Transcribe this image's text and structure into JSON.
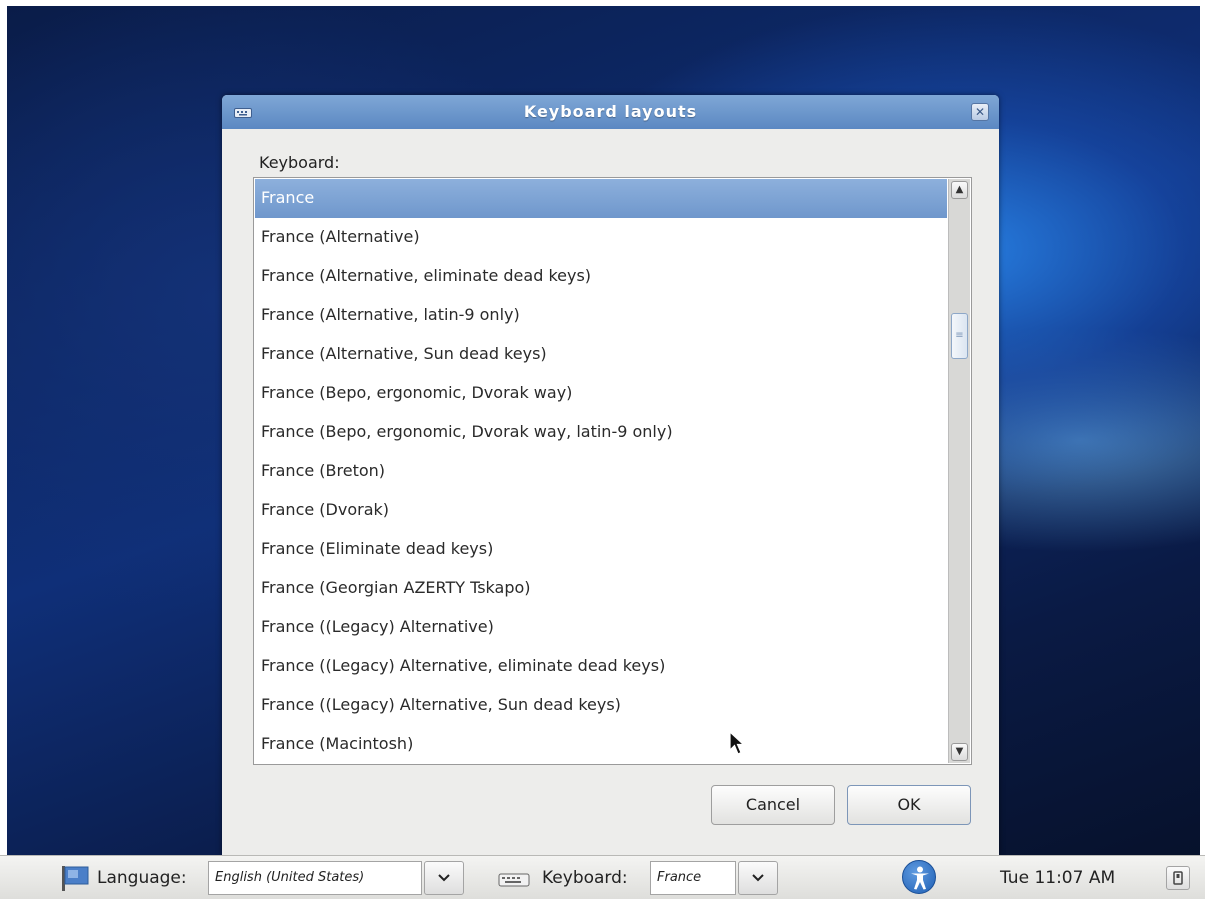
{
  "dialog": {
    "title": "Keyboard layouts",
    "keyboard_label": "Keyboard:",
    "layouts": [
      "France",
      "France (Alternative)",
      "France (Alternative, eliminate dead keys)",
      "France (Alternative, latin-9 only)",
      "France (Alternative, Sun dead keys)",
      "France (Bepo, ergonomic, Dvorak way)",
      "France (Bepo, ergonomic, Dvorak way, latin-9 only)",
      "France (Breton)",
      "France (Dvorak)",
      "France (Eliminate dead keys)",
      "France (Georgian AZERTY Tskapo)",
      "France ((Legacy) Alternative)",
      "France ((Legacy) Alternative, eliminate dead keys)",
      "France ((Legacy) Alternative, Sun dead keys)",
      "France (Macintosh)"
    ],
    "selected_layout": "France",
    "cancel_label": "Cancel",
    "ok_label": "OK",
    "close_glyph": "✕",
    "scroll_up_glyph": "▲",
    "scroll_down_glyph": "▼",
    "scroll_thumb_glyph": "≡"
  },
  "panel": {
    "language_label": "Language:",
    "language_value": "English (United States)",
    "keyboard_label": "Keyboard:",
    "keyboard_value": "France",
    "clock": "Tue 11:07 AM"
  },
  "icons": {
    "flag": "language-flag-icon",
    "keyboard": "keyboard-icon",
    "accessibility": "accessibility-icon",
    "power": "shutdown-icon",
    "cursor": "mouse-pointer-icon"
  },
  "colors": {
    "titlebar": "#6b95cb",
    "selection": "#7ea3d4",
    "panel": "#e8e8e6"
  }
}
